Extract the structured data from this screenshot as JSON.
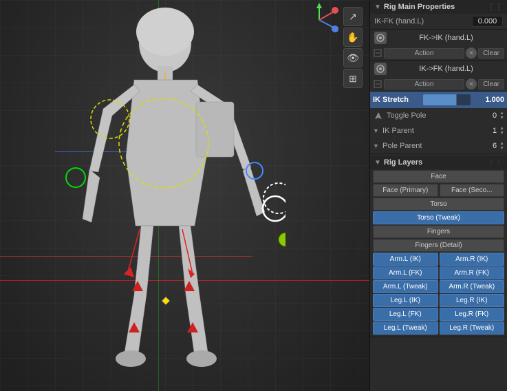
{
  "viewport": {
    "background": "#2a2a2a"
  },
  "toolbar": {
    "icons": [
      "↗",
      "✋",
      "👁",
      "⊞"
    ]
  },
  "axis_widget": {
    "x_color": "#e05050",
    "y_color": "#50e050",
    "z_color": "#5050e0"
  },
  "panel": {
    "rig_main_properties": {
      "title": "Rig Main Properties",
      "fk_ik_hand": {
        "label": "IK-FK (hand.L)",
        "value": "0.000"
      },
      "fk_to_ik": {
        "label": "FK->IK (hand.L)",
        "action_label": "Action",
        "clear_label": "Clear"
      },
      "ik_to_fk": {
        "label": "IK->FK (hand.L)",
        "action_label": "Action",
        "clear_label": "Clear"
      },
      "ik_stretch": {
        "label": "IK Stretch",
        "value": "1.000"
      },
      "toggle_pole": {
        "label": "Toggle Pole",
        "value": "0"
      },
      "ik_parent": {
        "label": "IK Parent",
        "value": "1"
      },
      "pole_parent": {
        "label": "Pole Parent",
        "value": "6"
      }
    },
    "rig_layers": {
      "title": "Rig Layers",
      "buttons": [
        {
          "label": "Face",
          "active": false,
          "full_width": true
        },
        {
          "label": "Face (Primary)",
          "active": false,
          "half": true
        },
        {
          "label": "Face (Seco...",
          "active": false,
          "half": true
        },
        {
          "label": "Torso",
          "active": false,
          "full_width": true
        },
        {
          "label": "Torso (Tweak)",
          "active": true,
          "full_width": true
        },
        {
          "label": "Fingers",
          "active": false,
          "full_width": true
        },
        {
          "label": "Fingers (Detail)",
          "active": false,
          "full_width": true
        },
        {
          "label": "Arm.L (IK)",
          "active": true,
          "half": true
        },
        {
          "label": "Arm.R (IK)",
          "active": true,
          "half": true
        },
        {
          "label": "Arm.L (FK)",
          "active": true,
          "half": true
        },
        {
          "label": "Arm.R (FK)",
          "active": true,
          "half": true
        },
        {
          "label": "Arm.L (Tweak)",
          "active": true,
          "half": true
        },
        {
          "label": "Arm.R (Tweak)",
          "active": true,
          "half": true
        },
        {
          "label": "Leg.L (IK)",
          "active": true,
          "half": true
        },
        {
          "label": "Leg.R (IK)",
          "active": true,
          "half": true
        },
        {
          "label": "Leg.L (FK)",
          "active": true,
          "half": true
        },
        {
          "label": "Leg.R (FK)",
          "active": true,
          "half": true
        },
        {
          "label": "Leg.L (Tweak)",
          "active": true,
          "half": true
        },
        {
          "label": "Leg.R (Tweak)",
          "active": true,
          "half": true
        }
      ]
    }
  }
}
